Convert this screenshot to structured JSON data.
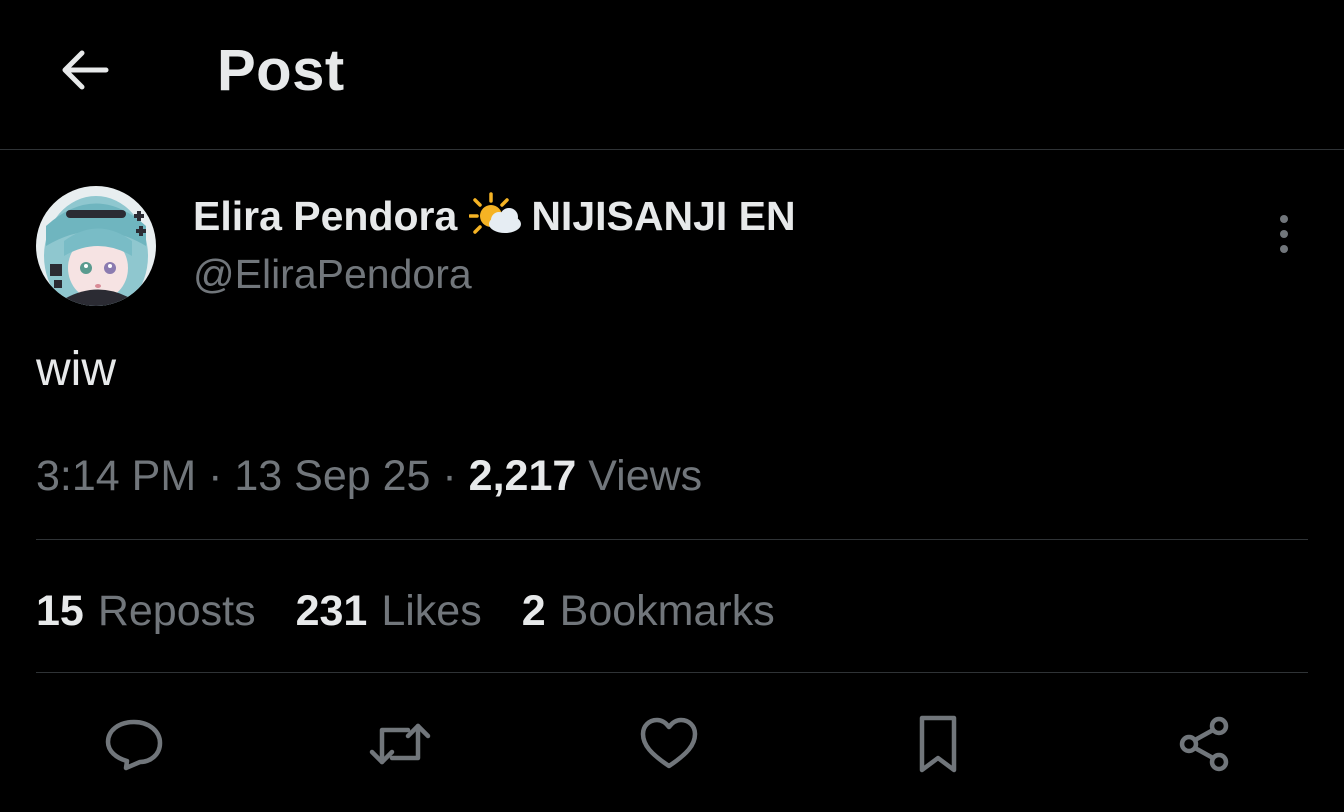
{
  "header": {
    "title": "Post",
    "back_icon": "arrow-left-icon"
  },
  "author": {
    "display_name": "Elira Pendora",
    "name_emoji": "sun-behind-cloud-icon",
    "org": "NIJISANJI EN",
    "handle": "@EliraPendora"
  },
  "post": {
    "text": "wiw",
    "time": "3:14 PM",
    "date": "13 Sep 25",
    "views_count": "2,217",
    "views_label": "Views",
    "separator": "·"
  },
  "stats": [
    {
      "count": "15",
      "label": "Reposts"
    },
    {
      "count": "231",
      "label": "Likes"
    },
    {
      "count": "2",
      "label": "Bookmarks"
    }
  ],
  "actions": [
    "reply-icon",
    "repost-icon",
    "like-icon",
    "bookmark-icon",
    "share-icon"
  ],
  "colors": {
    "background": "#000000",
    "primary_text": "#e7e9ea",
    "secondary_text": "#71767b",
    "divider": "#2f3336"
  }
}
